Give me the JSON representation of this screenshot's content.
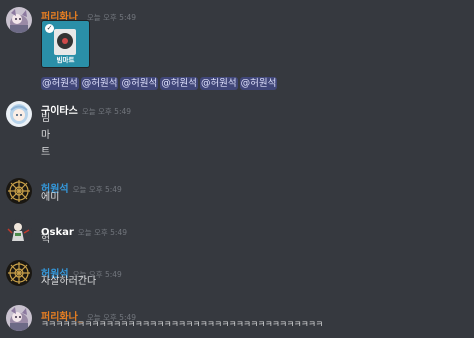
{
  "colors": {
    "background": "#36393f",
    "username_orange": "#e67e22",
    "username_white": "#ffffff",
    "username_blue": "#3498db",
    "mention_bg": "#4f5482",
    "timestamp": "#72767d"
  },
  "messages": [
    {
      "username": "퍼리화나_",
      "timestamp": "오늘 오후 5:49",
      "avatar_icon": "furry-character-avatar",
      "attachment_caption": "빔마트",
      "mentions": [
        "@허원석",
        "@허원석",
        "@허원석",
        "@허원석",
        "@허원석",
        "@허원석"
      ]
    },
    {
      "username": "구이타스",
      "timestamp": "오늘 오후 5:49",
      "avatar_icon": "anime-character-avatar",
      "lines": [
        "빔",
        "마",
        "트"
      ]
    },
    {
      "username": "허원석",
      "timestamp": "오늘 오후 5:49",
      "avatar_icon": "gold-emblem-avatar",
      "lines": [
        "에미"
      ]
    },
    {
      "username": "Oskar",
      "timestamp": "오늘 오후 5:49",
      "avatar_icon": "character-figure-avatar",
      "lines": [
        "헉"
      ]
    },
    {
      "username": "허원석",
      "timestamp": "오늘 오후 5:49",
      "avatar_icon": "gold-emblem-avatar",
      "lines": [
        "자살하러간다"
      ]
    },
    {
      "username": "퍼리화나_",
      "timestamp": "오늘 오후 5:49",
      "avatar_icon": "furry-character-avatar",
      "lines": [
        "ㅋㅋㅋㅋㅋㅋㅋㅋㅋㅋㅋㅋㅋㅋㅋㅋㅋㅋㅋㅋㅋㅋㅋㅋㅋㅋㅋㅋㅋㅋㅋㅋㅋㅋㅋㅋㅋㅋㅋ"
      ]
    }
  ]
}
